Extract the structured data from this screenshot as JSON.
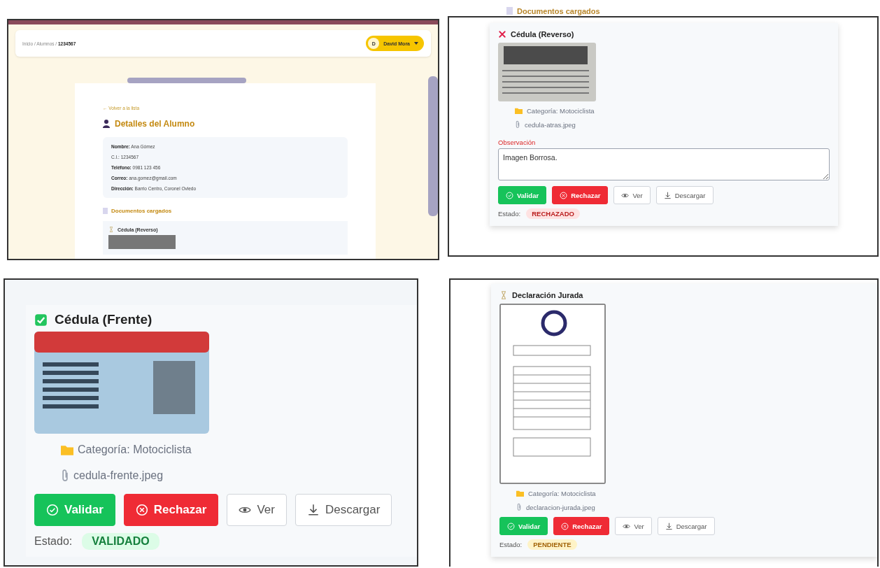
{
  "student_page": {
    "breadcrumb": "Inicio / Alumnos / **1234567**",
    "user_menu": {
      "initial": "D",
      "name": "David Mora"
    },
    "back_link": "← Volver a la lista",
    "title": "Detalles del Alumno",
    "fields": [
      "**Nombre:** Ana Gómez",
      "C.I.: 1234567",
      "**Teléfono:** 0981 123 456",
      "**Correo:** ana.gomez@gmail.com",
      "**Dirección:** Barrio Centro, Coronel Oviedo"
    ],
    "documents_heading": "Documentos cargados",
    "first_document": {
      "title": "Cédula (Reverso)",
      "kind": "pending"
    }
  },
  "documents_heading": "Documentos cargados",
  "documents": [
    {
      "title": "Cédula (Reverso)",
      "kind": "rejected",
      "category": "Categoría: Motociclista",
      "filename": "cedula-atras.jpeg",
      "observation": {
        "label": "Observación",
        "value": "Imagen Borrosa."
      },
      "buttons": [
        "Validar",
        "Rechazar",
        "Ver",
        "Descargar"
      ],
      "state_label": "Estado:",
      "badge": "RECHAZADO"
    },
    {
      "title": "Cédula (Frente)",
      "kind": "validated",
      "category": "Categoría: Motociclista",
      "filename": "cedula-frente.jpeg",
      "buttons": [
        "Validar",
        "Rechazar",
        "Ver",
        "Descargar"
      ],
      "state_label": "Estado:",
      "badge": "VALIDADO"
    },
    {
      "title": "Declaración Jurada",
      "kind": "pending",
      "category": "Categoría: Motociclista",
      "filename": "declaracion-jurada.jpeg",
      "buttons": [
        "Validar",
        "Rechazar",
        "Ver",
        "Descargar"
      ],
      "state_label": "Estado:",
      "badge": "PENDIENTE"
    }
  ]
}
